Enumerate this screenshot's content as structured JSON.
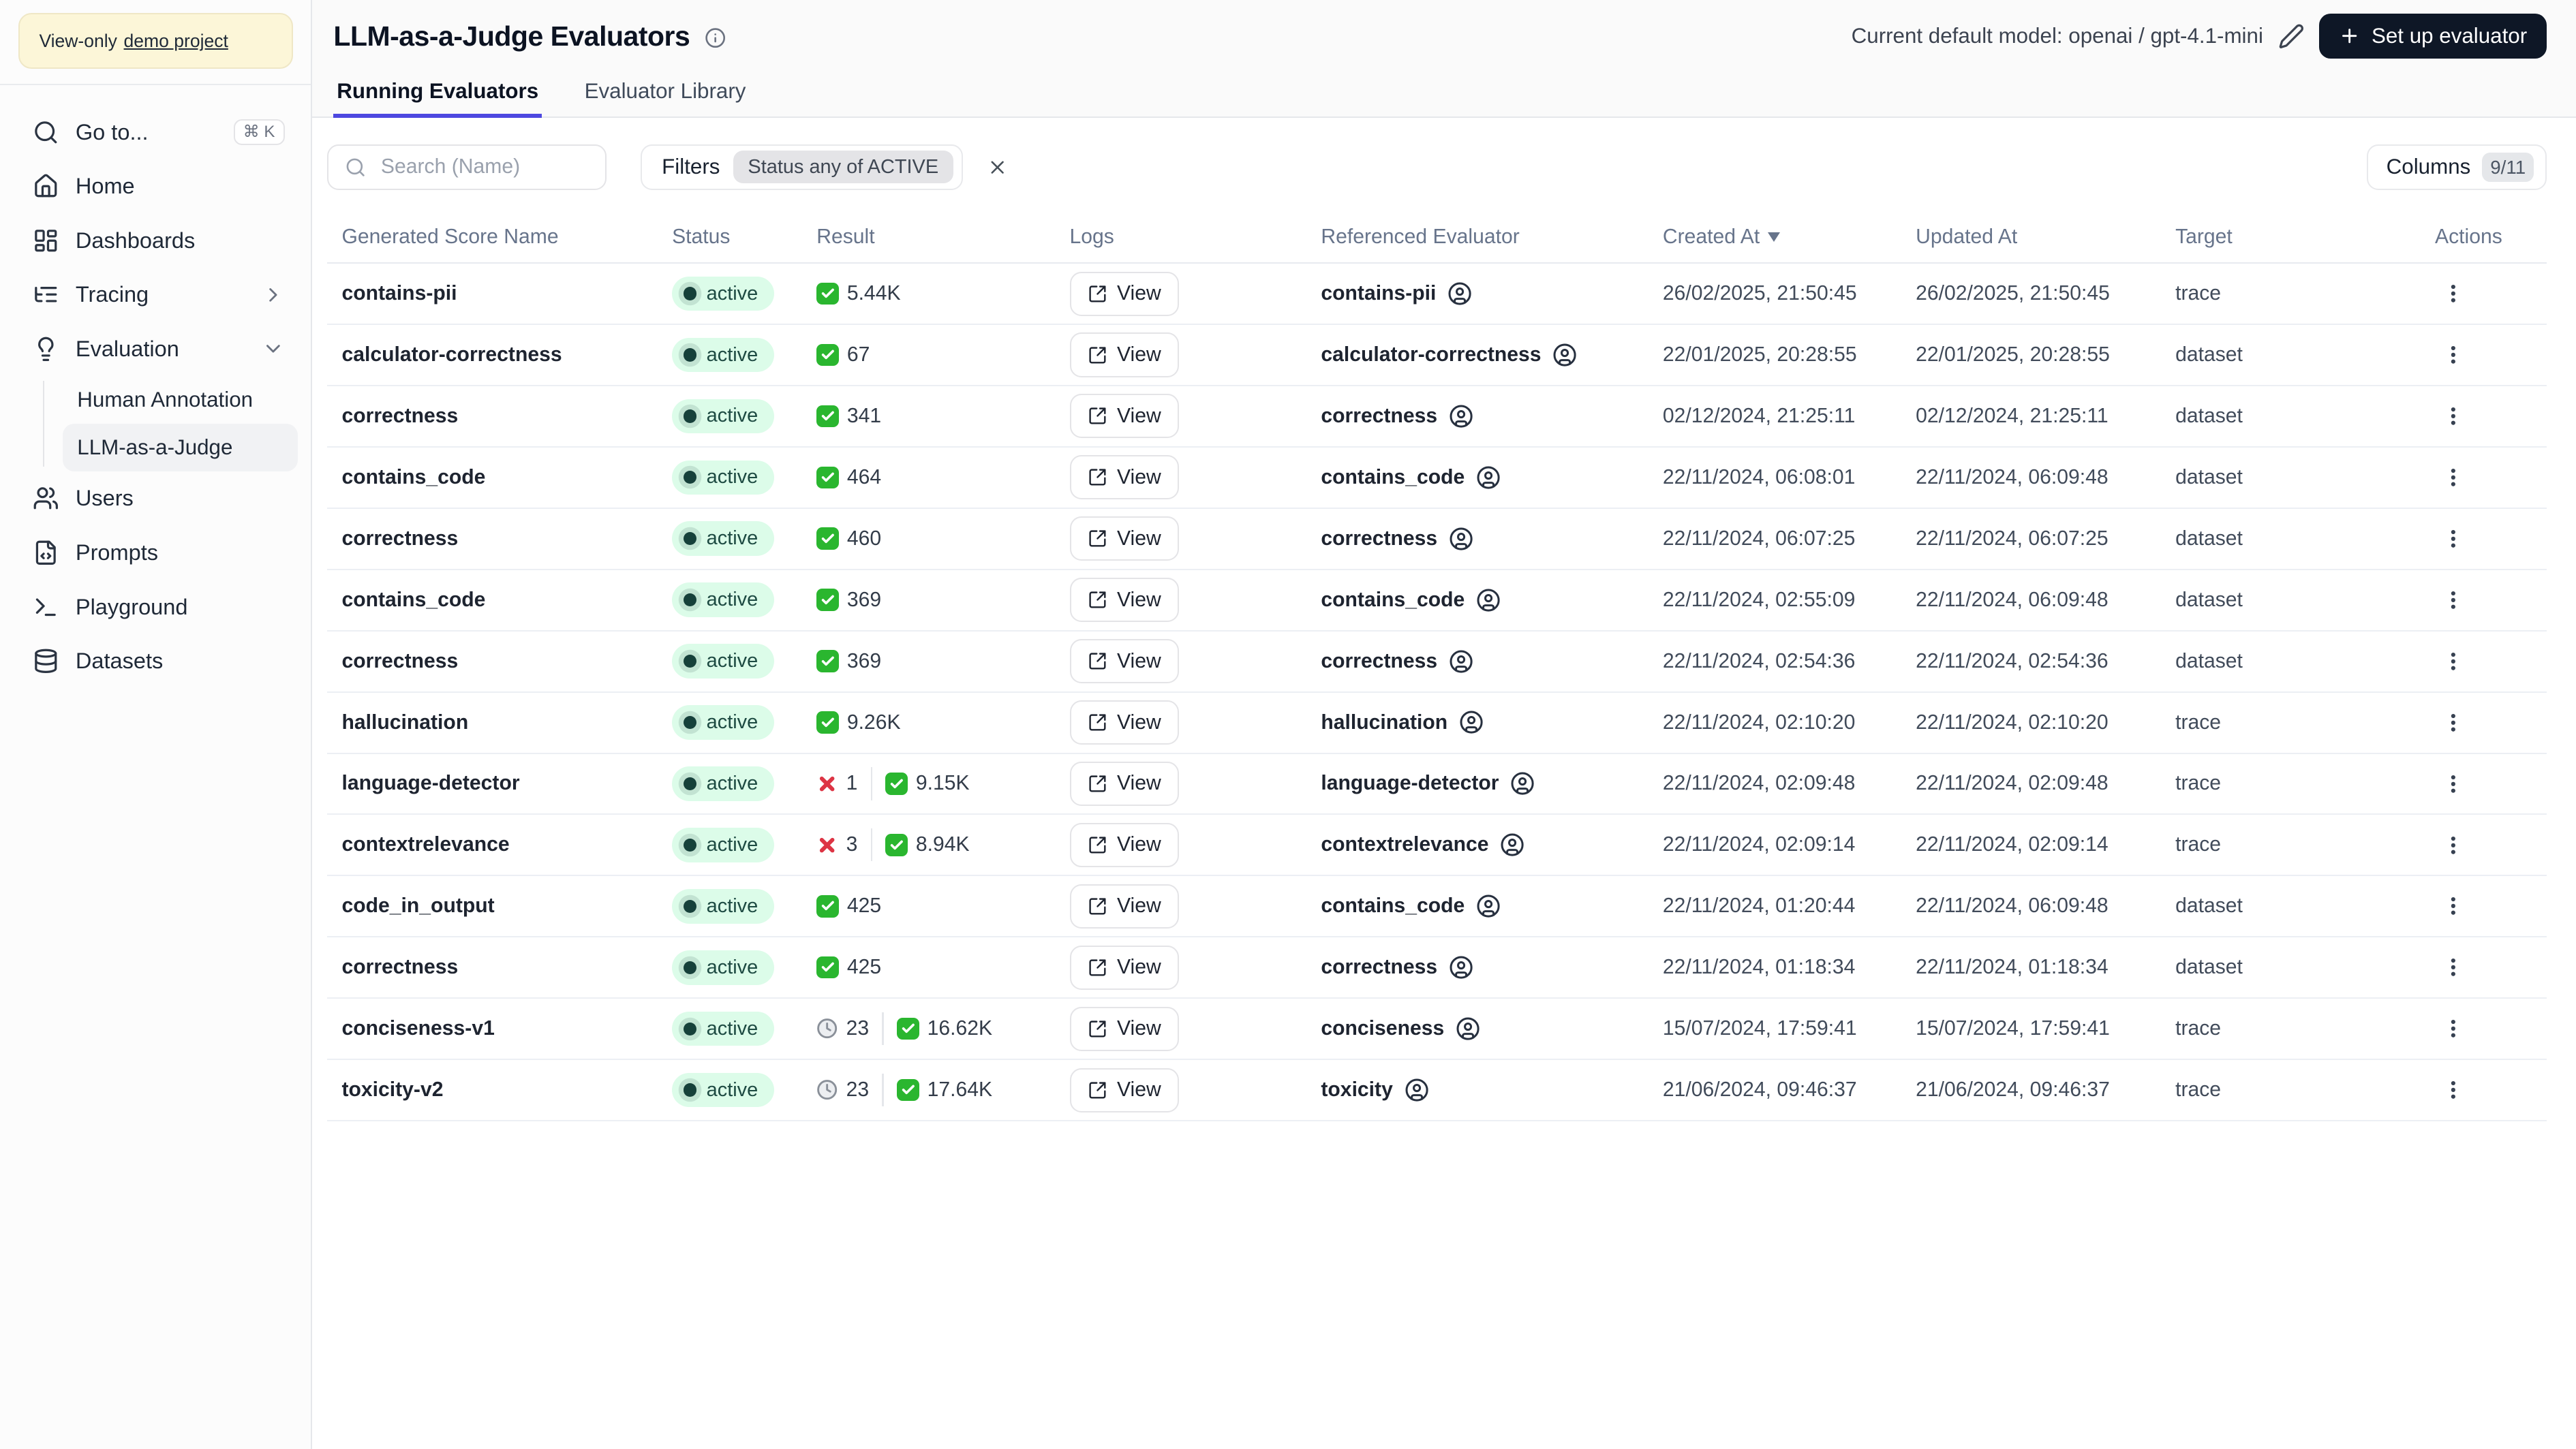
{
  "sidebar": {
    "banner": {
      "prefix": "View-only",
      "link_label": "demo project"
    },
    "items": [
      {
        "label": "Go to...",
        "icon": "search",
        "shortcut": "⌘ K"
      },
      {
        "label": "Home",
        "icon": "home"
      },
      {
        "label": "Dashboards",
        "icon": "dashboards"
      },
      {
        "label": "Tracing",
        "icon": "tracing",
        "chevron": "right"
      },
      {
        "label": "Evaluation",
        "icon": "evaluation",
        "chevron": "down"
      },
      {
        "label": "Human Annotation",
        "sub": true
      },
      {
        "label": "LLM-as-a-Judge",
        "sub": true,
        "active": true
      },
      {
        "label": "Users",
        "icon": "users"
      },
      {
        "label": "Prompts",
        "icon": "prompts"
      },
      {
        "label": "Playground",
        "icon": "playground"
      },
      {
        "label": "Datasets",
        "icon": "datasets"
      }
    ]
  },
  "header": {
    "title": "LLM-as-a-Judge Evaluators",
    "model_label": "Current default model: openai / gpt-4.1-mini",
    "setup_button_label": "Set up evaluator",
    "tabs": [
      {
        "label": "Running Evaluators",
        "active": true
      },
      {
        "label": "Evaluator Library",
        "active": false
      }
    ]
  },
  "toolbar": {
    "search_placeholder": "Search (Name)",
    "filters_label": "Filters",
    "filter_chip": "Status any of ACTIVE",
    "columns_label": "Columns",
    "columns_badge": "9/11"
  },
  "table": {
    "columns": [
      "Generated Score Name",
      "Status",
      "Result",
      "Logs",
      "Referenced Evaluator",
      "Created At",
      "Updated At",
      "Target",
      "Actions"
    ],
    "sort": {
      "column": "Created At",
      "direction": "desc"
    },
    "view_label": "View",
    "rows": [
      {
        "name": "contains-pii",
        "status": "active",
        "result": {
          "pass": "5.44K"
        },
        "evaluator": "contains-pii",
        "created": "26/02/2025, 21:50:45",
        "updated": "26/02/2025, 21:50:45",
        "target": "trace"
      },
      {
        "name": "calculator-correctness",
        "status": "active",
        "result": {
          "pass": "67"
        },
        "evaluator": "calculator-correctness",
        "created": "22/01/2025, 20:28:55",
        "updated": "22/01/2025, 20:28:55",
        "target": "dataset"
      },
      {
        "name": "correctness",
        "status": "active",
        "result": {
          "pass": "341"
        },
        "evaluator": "correctness",
        "created": "02/12/2024, 21:25:11",
        "updated": "02/12/2024, 21:25:11",
        "target": "dataset"
      },
      {
        "name": "contains_code",
        "status": "active",
        "result": {
          "pass": "464"
        },
        "evaluator": "contains_code",
        "created": "22/11/2024, 06:08:01",
        "updated": "22/11/2024, 06:09:48",
        "target": "dataset"
      },
      {
        "name": "correctness",
        "status": "active",
        "result": {
          "pass": "460"
        },
        "evaluator": "correctness",
        "created": "22/11/2024, 06:07:25",
        "updated": "22/11/2024, 06:07:25",
        "target": "dataset"
      },
      {
        "name": "contains_code",
        "status": "active",
        "result": {
          "pass": "369"
        },
        "evaluator": "contains_code",
        "created": "22/11/2024, 02:55:09",
        "updated": "22/11/2024, 06:09:48",
        "target": "dataset"
      },
      {
        "name": "correctness",
        "status": "active",
        "result": {
          "pass": "369"
        },
        "evaluator": "correctness",
        "created": "22/11/2024, 02:54:36",
        "updated": "22/11/2024, 02:54:36",
        "target": "dataset"
      },
      {
        "name": "hallucination",
        "status": "active",
        "result": {
          "pass": "9.26K"
        },
        "evaluator": "hallucination",
        "created": "22/11/2024, 02:10:20",
        "updated": "22/11/2024, 02:10:20",
        "target": "trace"
      },
      {
        "name": "language-detector",
        "status": "active",
        "result": {
          "error": "1",
          "pass": "9.15K"
        },
        "evaluator": "language-detector",
        "created": "22/11/2024, 02:09:48",
        "updated": "22/11/2024, 02:09:48",
        "target": "trace"
      },
      {
        "name": "contextrelevance",
        "status": "active",
        "result": {
          "error": "3",
          "pass": "8.94K"
        },
        "evaluator": "contextrelevance",
        "created": "22/11/2024, 02:09:14",
        "updated": "22/11/2024, 02:09:14",
        "target": "trace"
      },
      {
        "name": "code_in_output",
        "status": "active",
        "result": {
          "pass": "425"
        },
        "evaluator": "contains_code",
        "created": "22/11/2024, 01:20:44",
        "updated": "22/11/2024, 06:09:48",
        "target": "dataset"
      },
      {
        "name": "correctness",
        "status": "active",
        "result": {
          "pass": "425"
        },
        "evaluator": "correctness",
        "created": "22/11/2024, 01:18:34",
        "updated": "22/11/2024, 01:18:34",
        "target": "dataset"
      },
      {
        "name": "conciseness-v1",
        "status": "active",
        "result": {
          "pending": "23",
          "pass": "16.62K"
        },
        "evaluator": "conciseness",
        "created": "15/07/2024, 17:59:41",
        "updated": "15/07/2024, 17:59:41",
        "target": "trace"
      },
      {
        "name": "toxicity-v2",
        "status": "active",
        "result": {
          "pending": "23",
          "pass": "17.64K"
        },
        "evaluator": "toxicity",
        "created": "21/06/2024, 09:46:37",
        "updated": "21/06/2024, 09:46:37",
        "target": "trace"
      }
    ]
  },
  "colors": {
    "accent_indigo": "#4d48e0",
    "status_pill_bg": "#dcfce9",
    "status_dot": "#16403a",
    "check_green": "#2ab62f",
    "cross_red": "#dd3444",
    "primary_button_bg": "#0e1726",
    "banner_yellow_bg": "#fcf6d8"
  }
}
